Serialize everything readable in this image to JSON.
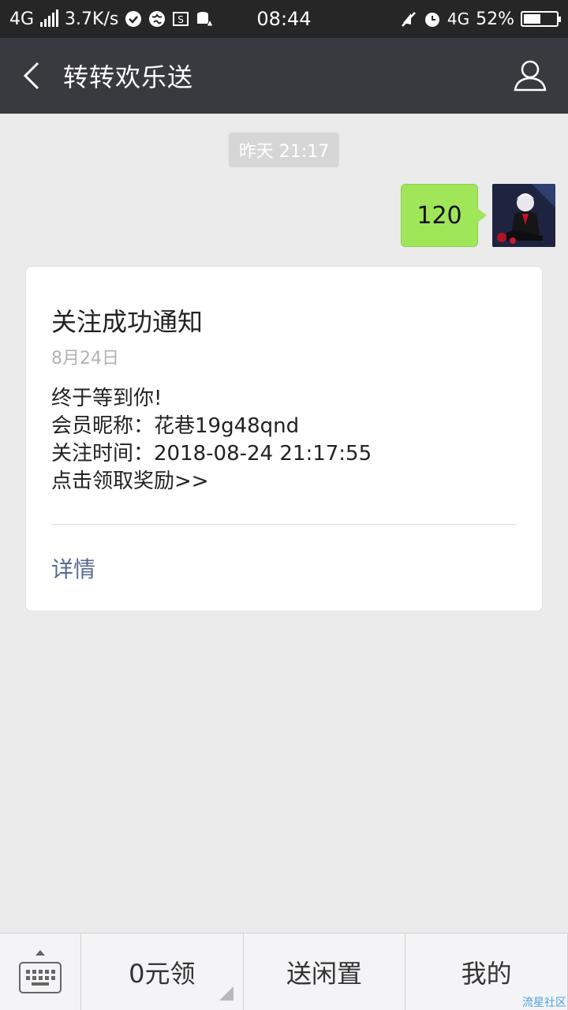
{
  "status_bar": {
    "network": "4G",
    "speed": "3.7K/s",
    "time": "08:44",
    "network2": "4G",
    "battery": "52%"
  },
  "header": {
    "title": "转转欢乐送"
  },
  "chat": {
    "timestamp": "昨天 21:17",
    "outgoing_message": "120"
  },
  "card": {
    "title": "关注成功通知",
    "date": "8月24日",
    "lines": [
      "终于等到你!",
      "会员昵称：花巷19g48qnd",
      "关注时间：2018-08-24 21:17:55",
      "点击领取奖励>>"
    ],
    "detail_label": "详情"
  },
  "bottom_menu": {
    "items": [
      "0元领",
      "送闲置",
      "我的"
    ]
  },
  "watermark": "流星社区",
  "colors": {
    "header_bg": "#393a3f",
    "bubble_green": "#9fe658",
    "link_blue": "#576b95"
  }
}
